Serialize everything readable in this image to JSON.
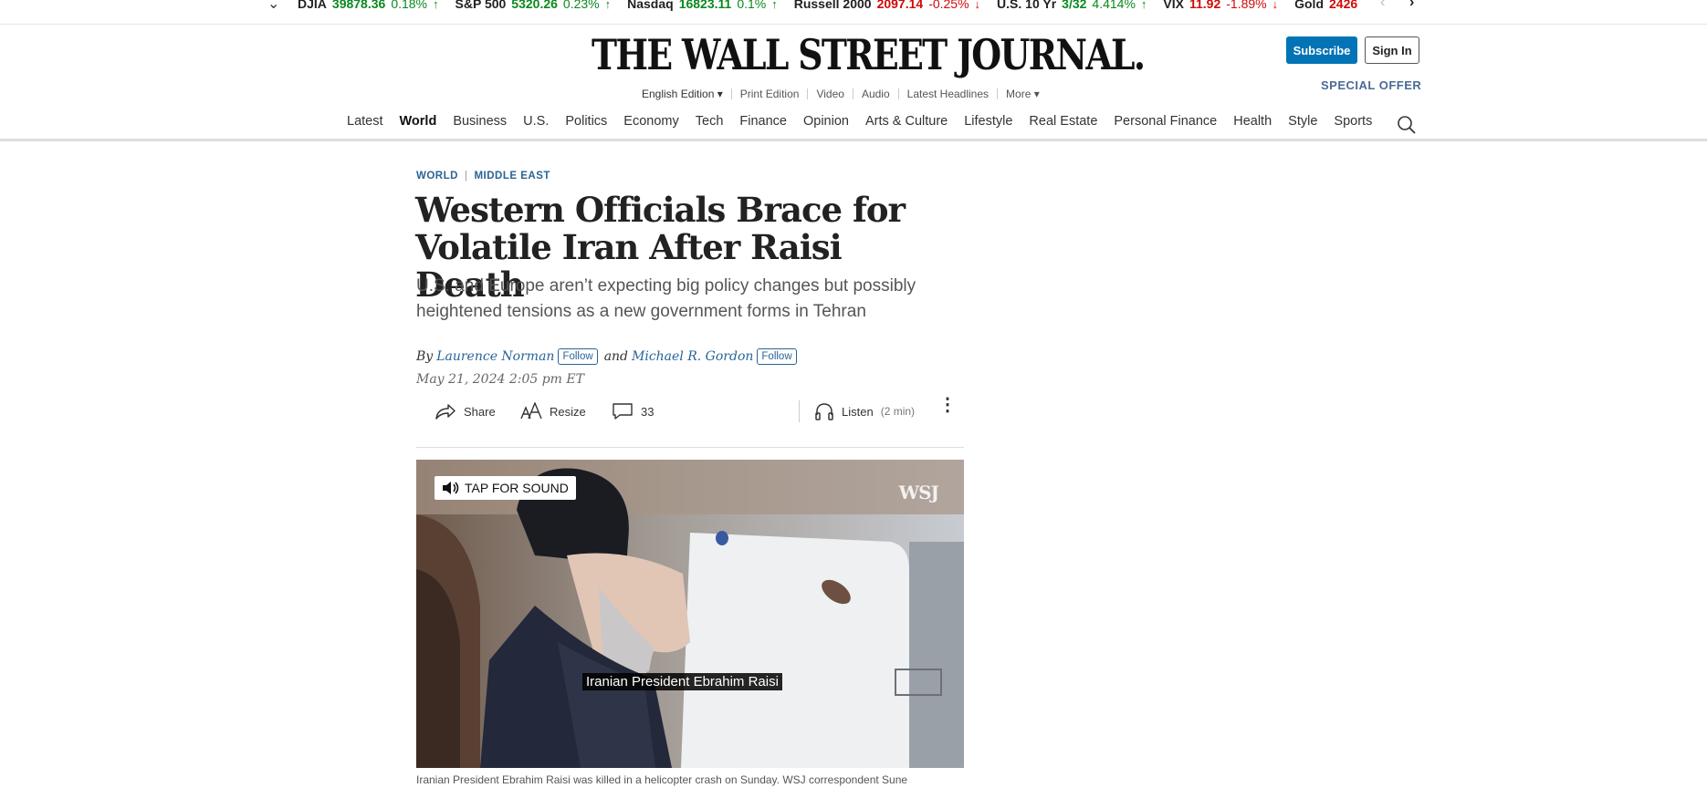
{
  "ticker": {
    "items": [
      {
        "name": "DJIA",
        "value": "39878.36",
        "change": "0.18%",
        "dir": "up"
      },
      {
        "name": "S&P 500",
        "value": "5320.26",
        "change": "0.23%",
        "dir": "up"
      },
      {
        "name": "Nasdaq",
        "value": "16823.11",
        "change": "0.1%",
        "dir": "up"
      },
      {
        "name": "Russell 2000",
        "value": "2097.14",
        "change": "-0.25%",
        "dir": "down"
      },
      {
        "name": "U.S. 10 Yr",
        "value": "3/32",
        "change": "4.414%",
        "dir": "up"
      },
      {
        "name": "VIX",
        "value": "11.92",
        "change": "-1.89%",
        "dir": "down"
      },
      {
        "name": "Gold",
        "value": "2426",
        "change": "",
        "dir": "down"
      }
    ],
    "colors": {
      "up": "#0a8a1f",
      "down": "#d10a0a"
    }
  },
  "masthead": {
    "logo": "THE WALL STREET JOURNAL.",
    "subscribe": "Subscribe",
    "sign_in": "Sign In",
    "special_offer": "SPECIAL OFFER",
    "sub_nav": [
      "English Edition ▾",
      "Print Edition",
      "Video",
      "Audio",
      "Latest Headlines",
      "More ▾"
    ]
  },
  "nav": {
    "items": [
      "Latest",
      "World",
      "Business",
      "U.S.",
      "Politics",
      "Economy",
      "Tech",
      "Finance",
      "Opinion",
      "Arts & Culture",
      "Lifestyle",
      "Real Estate",
      "Personal Finance",
      "Health",
      "Style",
      "Sports"
    ],
    "active": "World"
  },
  "article": {
    "section": "WORLD",
    "subsection": "MIDDLE EAST",
    "headline": "Western Officials Brace for Volatile Iran After Raisi Death",
    "dek": "U.S. and Europe aren’t expecting big policy changes but possibly heightened tensions as a new government forms in Tehran",
    "by": "By",
    "author1": "Laurence Norman",
    "and": "and",
    "author2": "Michael R. Gordon",
    "follow": "Follow",
    "date": "May 21, 2024 2:05 pm ET",
    "tools": {
      "share": "Share",
      "resize": "Resize",
      "comments": "33",
      "listen": "Listen",
      "listen_time": "(2 min)"
    }
  },
  "video": {
    "sound": "TAP FOR SOUND",
    "brand": "WSJ",
    "overlay_caption": "Iranian President Ebrahim Raisi",
    "caption": "Iranian President Ebrahim Raisi was killed in a helicopter crash on Sunday. WSJ correspondent Sune"
  }
}
